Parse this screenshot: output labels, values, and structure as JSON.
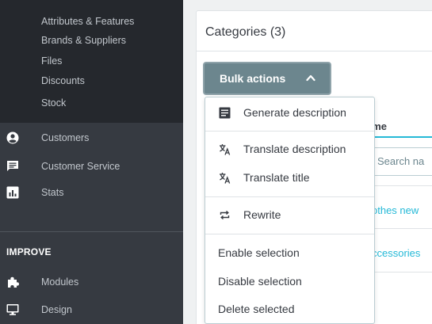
{
  "sidebar": {
    "submenu": [
      {
        "label": "Attributes & Features"
      },
      {
        "label": "Brands & Suppliers"
      },
      {
        "label": "Files"
      },
      {
        "label": "Discounts"
      },
      {
        "label": "Stock"
      }
    ],
    "nav": [
      {
        "label": "Customers",
        "icon": "account-circle-icon"
      },
      {
        "label": "Customer Service",
        "icon": "chat-icon"
      },
      {
        "label": "Stats",
        "icon": "bar-chart-icon"
      }
    ],
    "section_title": "IMPROVE",
    "improve_nav": [
      {
        "label": "Modules",
        "icon": "puzzle-icon"
      },
      {
        "label": "Design",
        "icon": "desktop-icon"
      }
    ]
  },
  "panel": {
    "title": "Categories (3)"
  },
  "bulk_actions": {
    "label": "Bulk actions",
    "menu": [
      {
        "label": "Generate description",
        "icon": "article-icon"
      },
      {
        "label": "Translate description",
        "icon": "translate-icon"
      },
      {
        "label": "Translate title",
        "icon": "translate-icon"
      },
      {
        "label": "Rewrite",
        "icon": "repeat-icon"
      },
      {
        "label": "Enable selection"
      },
      {
        "label": "Disable selection"
      },
      {
        "label": "Delete selected"
      }
    ]
  },
  "table": {
    "column_name": "ame",
    "search_placeholder": "Search na",
    "rows": [
      {
        "name": "othes new"
      },
      {
        "name": "ccessories"
      },
      {
        "name": "t"
      }
    ]
  },
  "colors": {
    "sidebar_bg": "#363a41",
    "submenu_bg": "#25282d",
    "bulk_button": "#6c868e",
    "link": "#25b9d7"
  }
}
